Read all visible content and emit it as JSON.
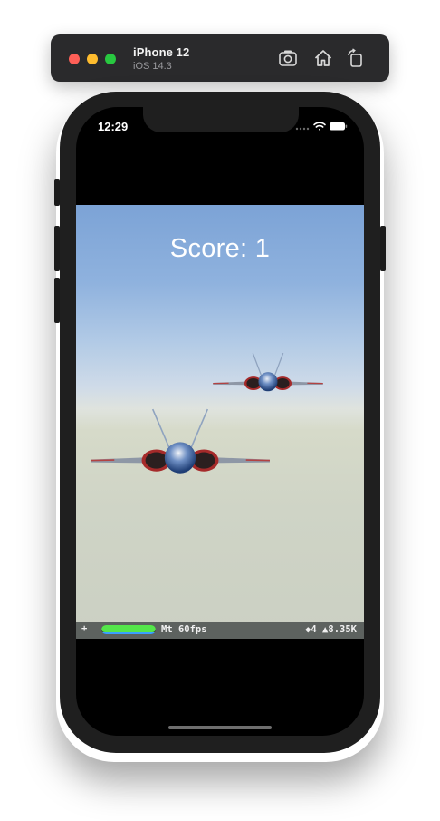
{
  "simulator": {
    "device_name": "iPhone 12",
    "os_version": "iOS 14.3",
    "toolbar_icons": [
      "screenshot-icon",
      "home-icon",
      "rotate-icon"
    ]
  },
  "status_bar": {
    "time": "12:29",
    "icons": [
      "cellular-dots-icon",
      "wifi-icon",
      "battery-icon"
    ]
  },
  "game": {
    "score_text": "Score: 1",
    "sky_colors": {
      "top": "#7ca3d6",
      "horizon": "#dfe3de",
      "ground": "#cbd0c3"
    },
    "jet_colors": {
      "body": "#2f5a9c",
      "intake": "#a52a2a"
    }
  },
  "stats_hud": {
    "toggle": "+",
    "left": "Mt 60fps",
    "right": "◆4 ▲8.35K",
    "frame_bar_fraction": 1.0,
    "colors": {
      "bar": "#54e64a",
      "underline": "#3aa0ff"
    }
  }
}
